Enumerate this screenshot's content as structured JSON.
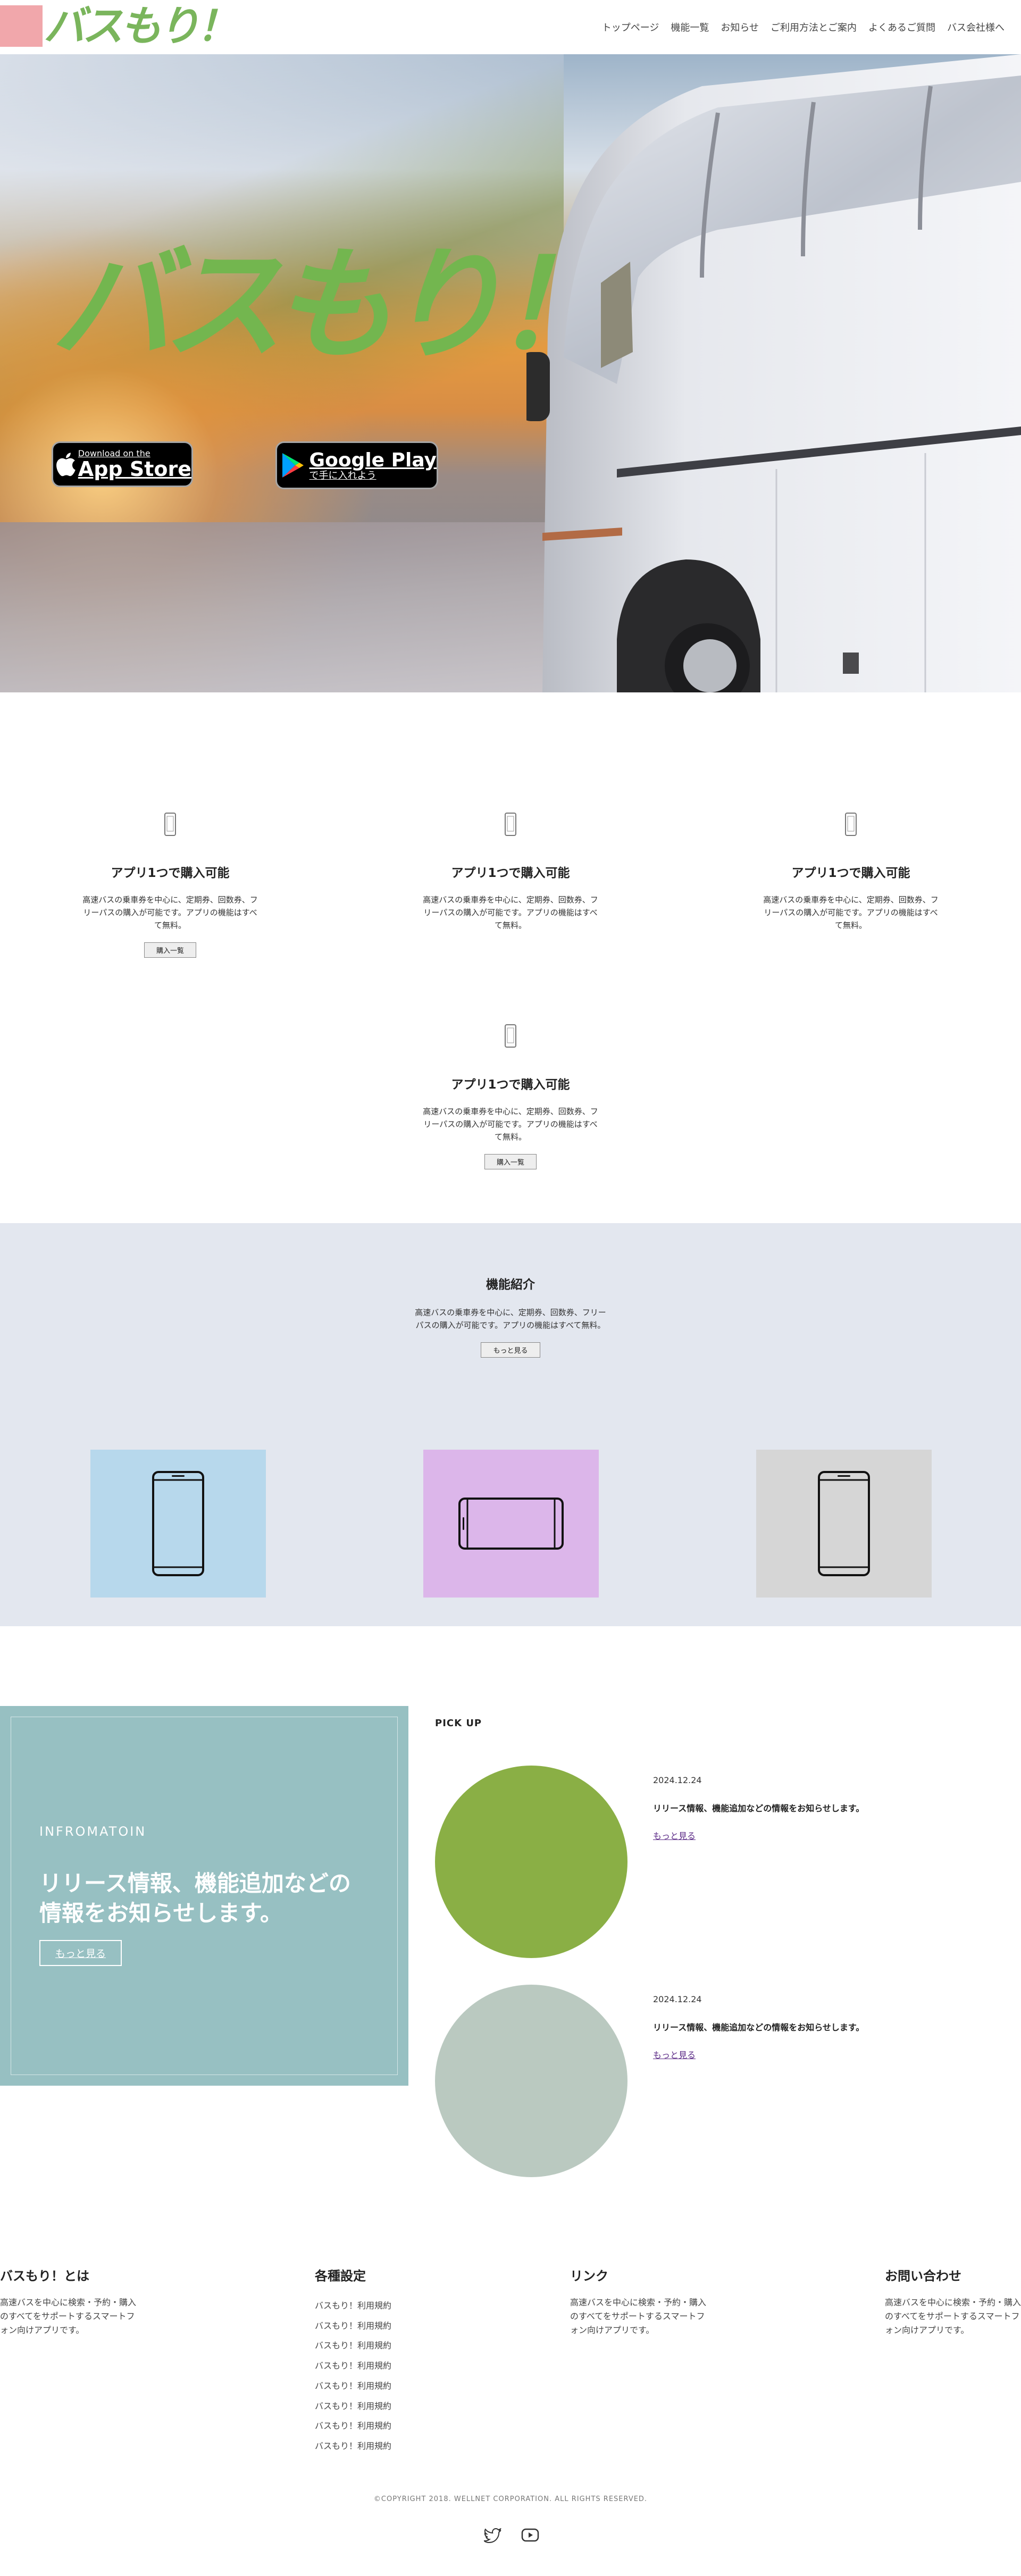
{
  "header": {
    "logo_text": "バスもり！",
    "nav": [
      "トップページ",
      "機能一覧",
      "お知らせ",
      "ご利用方法とご案内",
      "よくあるご質問",
      "バス会社様へ"
    ]
  },
  "hero": {
    "title": "バスもり！",
    "appstore": {
      "line1": "Download on the",
      "line2": "App Store"
    },
    "googleplay": {
      "line1": "で手に入れよう",
      "line2": "Google Play"
    }
  },
  "features": [
    {
      "title": "アプリ1つで購入可能",
      "text": "高速バスの乗車券を中心に、定期券、回数券、フリーパスの購入が可能です。アプリの機能はすべて無料。",
      "button": "購入一覧"
    },
    {
      "title": "アプリ1つで購入可能",
      "text": "高速バスの乗車券を中心に、定期券、回数券、フリーパスの購入が可能です。アプリの機能はすべて無料。",
      "button": ""
    },
    {
      "title": "アプリ1つで購入可能",
      "text": "高速バスの乗車券を中心に、定期券、回数券、フリーパスの購入が可能です。アプリの機能はすべて無料。",
      "button": ""
    },
    {
      "title": "アプリ1つで購入可能",
      "text": "高速バスの乗車券を中心に、定期券、回数券、フリーパスの購入が可能です。アプリの機能はすべて無料。",
      "button": "購入一覧"
    }
  ],
  "intro": {
    "title": "機能紹介",
    "text": "高速バスの乗車券を中心に、定期券、回数券、フリーパスの購入が可能です。アプリの機能はすべて無料。",
    "button": "もっと見る",
    "tiles": [
      {
        "color": "#b7d8ec",
        "icon": "smartphone-portrait-icon"
      },
      {
        "color": "#dcb6ea",
        "icon": "smartphone-landscape-icon"
      },
      {
        "color": "#d6d6d6",
        "icon": "smartphone-portrait-icon"
      }
    ]
  },
  "news": {
    "label": "INFROMATOIN",
    "headline": "リリース情報、機能追加などの情報をお知らせします。",
    "more": "もっと見る",
    "pickup": "PICK UP",
    "posts": [
      {
        "date": "2024.12.24",
        "title": "リリース情報、機能追加などの情報をお知らせします。",
        "link": "もっと見る",
        "color": "#8aaf45"
      },
      {
        "date": "2024.12.24",
        "title": "リリース情報、機能追加などの情報をお知らせします。",
        "link": "もっと見る",
        "color": "#bac9c0"
      }
    ]
  },
  "footer": {
    "about": {
      "title": "バスもり！とは",
      "text": "高速バスを中心に検索・予約・購入のすべてをサポートするスマートフォン向けアプリです。"
    },
    "settings": {
      "title": "各種設定",
      "items": [
        "バスもり！利用規約",
        "バスもり！利用規約",
        "バスもり！利用規約",
        "バスもり！利用規約",
        "バスもり！利用規約",
        "バスもり！利用規約",
        "バスもり！利用規約",
        "バスもり！利用規約"
      ]
    },
    "links": {
      "title": "リンク",
      "text": "高速バスを中心に検索・予約・購入のすべてをサポートするスマートフォン向けアプリです。"
    },
    "contact": {
      "title": "お問い合わせ",
      "text": "高速バスを中心に検索・予約・購入のすべてをサポートするスマートフォン向けアプリです。"
    },
    "copyright": "©COPYRIGHT 2018. WELLNET CORPORATION. ALL RIGHTS RESERVED.",
    "social": [
      "twitter-icon",
      "youtube-icon"
    ]
  }
}
